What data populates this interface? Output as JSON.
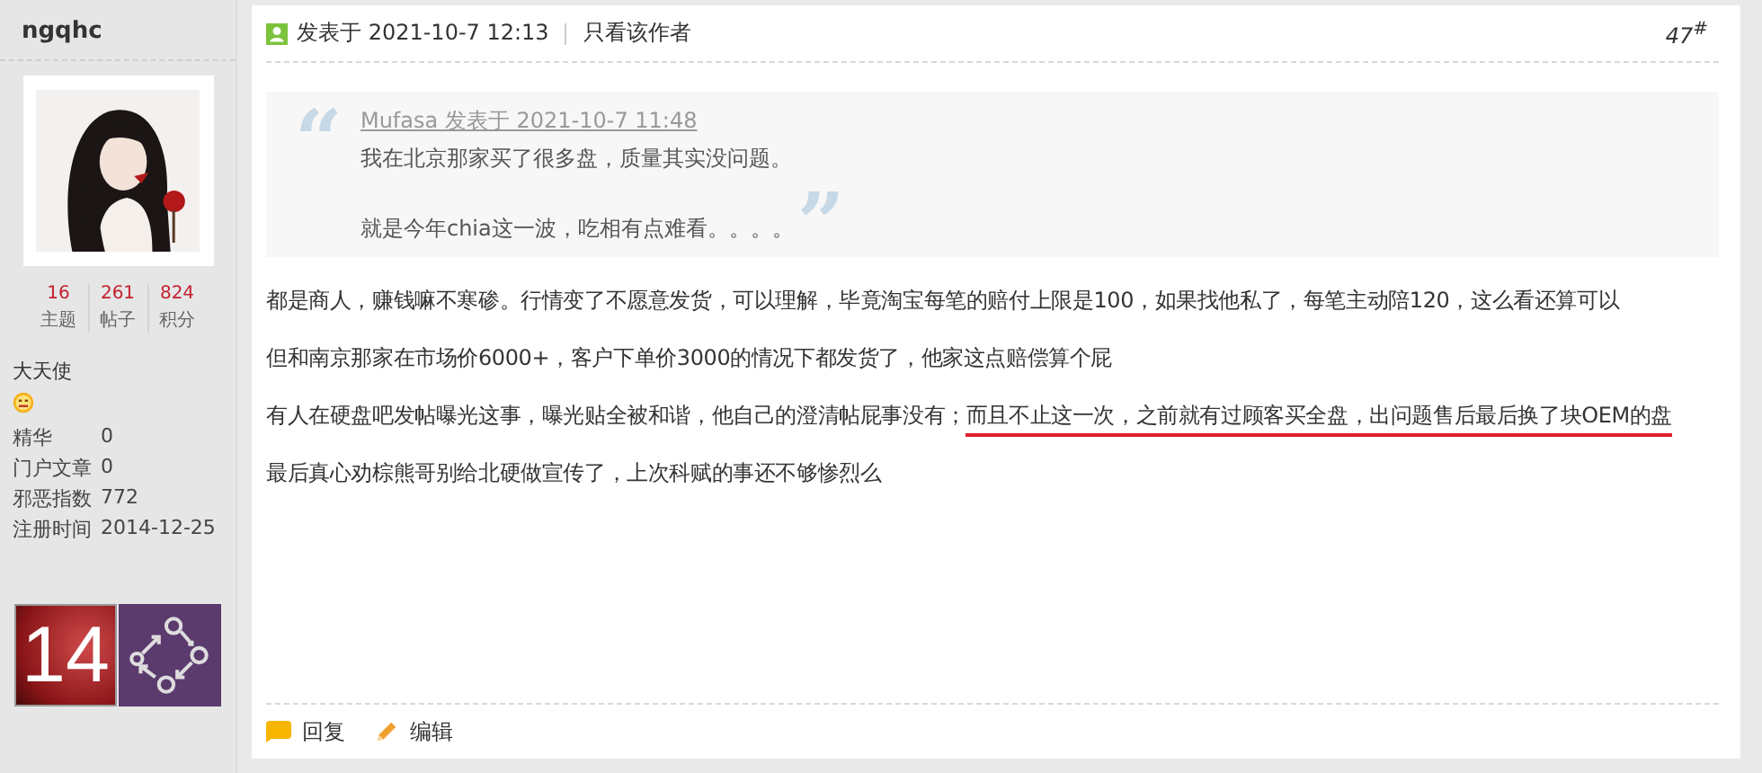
{
  "author": {
    "name": "ngqhc",
    "stats": [
      {
        "value": "16",
        "label": "主题"
      },
      {
        "value": "261",
        "label": "帖子"
      },
      {
        "value": "824",
        "label": "积分"
      }
    ],
    "rank": "大天使",
    "fields": [
      {
        "label": "精华",
        "value": "0"
      },
      {
        "label": "门户文章",
        "value": "0"
      },
      {
        "label": "邪恶指数",
        "value": "772"
      },
      {
        "label": "注册时间",
        "value": "2014-12-25"
      }
    ],
    "medals": [
      {
        "kind": "number",
        "text": "14"
      },
      {
        "kind": "network"
      }
    ]
  },
  "post": {
    "posted": "发表于 2021-10-7 12:13",
    "author_only": "只看该作者",
    "floor": "47$^{#}$",
    "quote": {
      "open_mark": "“",
      "close_mark": "”",
      "source": "Mufasa 发表于 2021-10-7 11:48",
      "lines": [
        "我在北京那家买了很多盘，质量其实没问题。",
        "就是今年chia这一波，吃相有点难看。。。。"
      ]
    },
    "paragraphs": [
      {
        "segments": [
          {
            "text": "都是商人，赚钱嘛不寒碜。行情变了不愿意发货，可以理解，毕竟淘宝每笔的赔付上限是100，如果找他私了，每笔主动陪120，这么看还算可以",
            "underlined": false
          }
        ]
      },
      {
        "segments": [
          {
            "text": "但和南京那家在市场价6000+，客户下单价3000的情况下都发货了，他家这点赔偿算个屁",
            "underlined": false
          }
        ]
      },
      {
        "segments": [
          {
            "text": "有人在硬盘吧发帖曝光这事，曝光贴全被和谐，他自己的澄清帖屁事没有；",
            "underlined": false
          },
          {
            "text": "而且不止这一次，之前就有过顾客买全盘，出问题售后最后换了块OEM的盘",
            "underlined": true
          }
        ]
      },
      {
        "segments": [
          {
            "text": "最后真心劝棕熊哥别给北硬做宣传了，上次科赋的事还不够惨烈么",
            "underlined": false
          }
        ]
      }
    ],
    "actions": [
      {
        "kind": "reply",
        "label": "回复"
      },
      {
        "kind": "edit",
        "label": "编辑"
      }
    ]
  }
}
